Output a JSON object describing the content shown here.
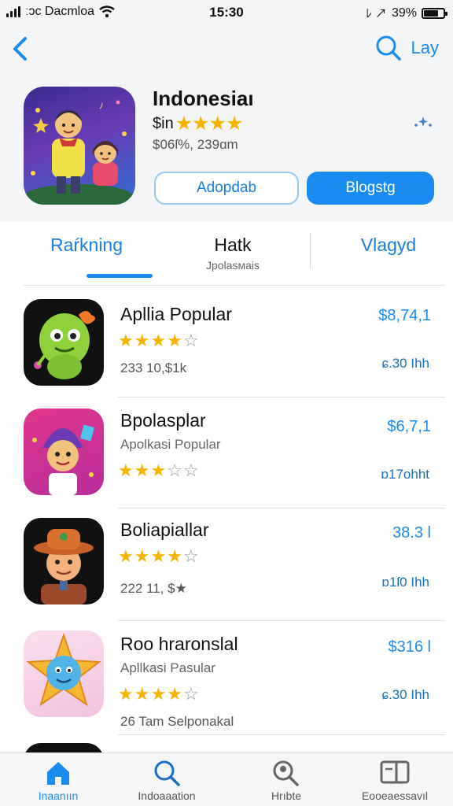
{
  "status_bar": {
    "carrier": "ːɔc Dacmloa",
    "time": "15:30",
    "battery_percent": "39%",
    "battery_level": 0.8
  },
  "nav": {
    "search_label": "Lay"
  },
  "featured": {
    "title": "Indonesiaı",
    "price_prefix": "$in",
    "stars": 4,
    "meta": "$06ſ%, 239ɑm",
    "button_outline": "Adopdab",
    "button_filled": "Blogstg",
    "accent": "#1a8cf0"
  },
  "tabs": [
    {
      "label": "Raŕkning",
      "sub": ""
    },
    {
      "label": "Hatk",
      "sub": "Jpolasмais"
    },
    {
      "label": "Vlagyd",
      "sub": ""
    }
  ],
  "apps": [
    {
      "title": "Apllia Popular",
      "subtitle": "",
      "rating": "★★★★☆",
      "rating_value": 4,
      "stat": "233 10,$1k",
      "price": "$8,74,1",
      "size": "ɕ.30 Ihh"
    },
    {
      "title": "Bpolasplar",
      "subtitle": "Apolkasi Popular",
      "rating": "★★★☆☆",
      "rating_value": 3,
      "stat": "",
      "price": "$6,7,1",
      "size": "ɒ17ohht"
    },
    {
      "title": "Boliapiallar",
      "subtitle": "",
      "rating": "★★★★☆",
      "rating_value": 4,
      "stat": "222 11, $★",
      "price": "38.3 l",
      "size": "ɒ1ſ0 Ihh"
    },
    {
      "title": "Roo hraronslal",
      "subtitle": "Apllkasi Pasular",
      "rating": "★★★★☆",
      "rating_value": 4,
      "stat": "26 Tam Selponakal",
      "price": "$316 l",
      "size": "ɕ.30 Ihh"
    }
  ],
  "tab_bar": [
    {
      "label": "Inaanıın",
      "icon": "home-icon",
      "active": true
    },
    {
      "label": "Indoaaation",
      "icon": "search-icon",
      "active": false
    },
    {
      "label": "Hrıbte",
      "icon": "search-people-icon",
      "active": false
    },
    {
      "label": "Eooeaessavıl",
      "icon": "updates-icon",
      "active": false
    }
  ]
}
